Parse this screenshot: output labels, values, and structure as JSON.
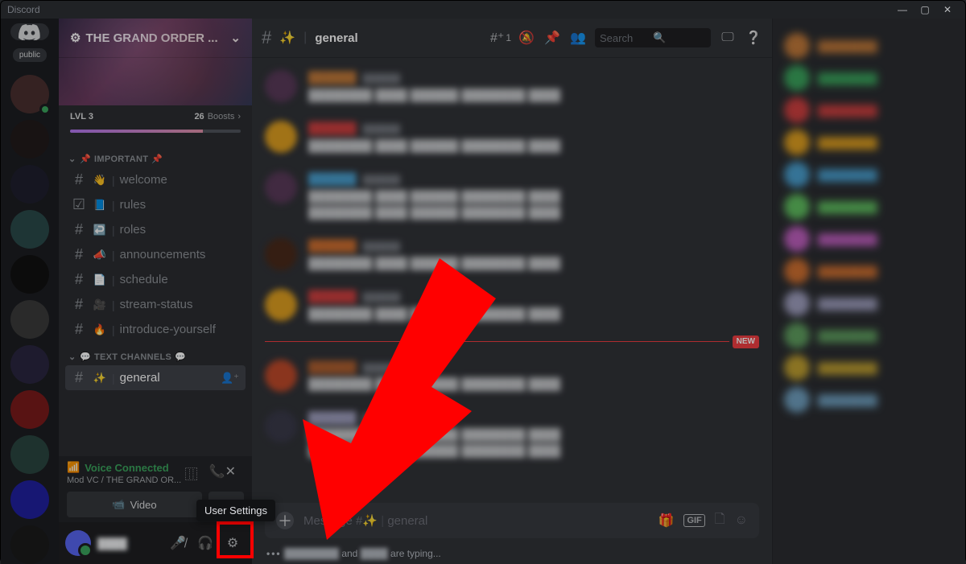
{
  "app_title": "Discord",
  "window": {
    "min": "—",
    "max": "▢",
    "close": "✕"
  },
  "rail": {
    "folder_label": "public",
    "guilds": [
      {
        "bg": "#4a2f2f"
      },
      {
        "bg": "#221a1a"
      },
      {
        "bg": "#1e1e2e"
      },
      {
        "bg": "#2a4a4a"
      },
      {
        "bg": "#111"
      },
      {
        "bg": "#3a3a3a"
      },
      {
        "bg": "#2a2640"
      },
      {
        "bg": "#7a1a1a"
      },
      {
        "bg": "#2a4640"
      },
      {
        "bg": "#2020a0"
      },
      {
        "bg": "#1a1a1a"
      }
    ]
  },
  "server": {
    "name_display": "THE GRAND ORDER ...",
    "boost_level": "LVL 3",
    "boost_count": "26",
    "boost_label": "Boosts"
  },
  "categories": [
    {
      "label": "IMPORTANT",
      "prefix": "📌",
      "suffix": "📌"
    },
    {
      "label": "TEXT CHANNELS",
      "prefix": "💬",
      "suffix": "💬"
    }
  ],
  "channels": [
    {
      "emoji": "👋",
      "name": "welcome"
    },
    {
      "emoji": "📘",
      "name": "rules",
      "icon_override": "☑"
    },
    {
      "emoji": "↩️",
      "name": "roles"
    },
    {
      "emoji": "📣",
      "name": "announcements"
    },
    {
      "emoji": "📄",
      "name": "schedule"
    },
    {
      "emoji": "🎥",
      "name": "stream-status"
    },
    {
      "emoji": "🔥",
      "name": "introduce-yourself"
    }
  ],
  "active_channel": {
    "emoji": "✨",
    "name": "general"
  },
  "voice": {
    "status": "Voice Connected",
    "sub": "Mod VC / THE GRAND OR...",
    "video_label": "Video"
  },
  "user_panel": {
    "username": "████"
  },
  "chat_header": {
    "channel_emoji": "✨",
    "channel_name": "general",
    "thread_count": "1",
    "search_placeholder": "Search"
  },
  "messages": [
    {
      "avatar": "#5a3a5a",
      "name_color": "#c27a3a",
      "lines": 1
    },
    {
      "avatar": "#e0a020",
      "name_color": "#d04040",
      "lines": 1
    },
    {
      "avatar": "#5a3a5a",
      "name_color": "#4aa0d0",
      "lines": 2
    },
    {
      "avatar": "#4a2a1a",
      "name_color": "#d07030",
      "lines": 1
    },
    {
      "avatar": "#e0a020",
      "name_color": "#d04040",
      "lines": 1
    },
    {
      "avatar": "#c04a2a",
      "name_color": "#b06030",
      "lines": 1,
      "after_divider": true
    },
    {
      "avatar": "#3a3a4a",
      "name_color": "#a0a0c0",
      "lines": 2
    }
  ],
  "divider_label": "NEW",
  "composer": {
    "placeholder_prefix": "Message #",
    "placeholder_emoji": "✨",
    "placeholder_channel": "general"
  },
  "typing": {
    "mid": "and",
    "tail": "are typing..."
  },
  "member_colors": [
    "#c27a3a",
    "#3ba55d",
    "#d04040",
    "#e0a020",
    "#4aa0d0",
    "#60c060",
    "#c060c0",
    "#d07030",
    "#a0a0c0",
    "#60a060",
    "#c0a030",
    "#70a0c0"
  ],
  "tooltip": "User Settings"
}
